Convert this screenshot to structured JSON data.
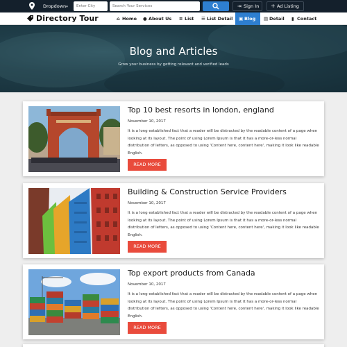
{
  "topbar": {
    "location_icon": "map-pin-icon",
    "dropdown_label": "Dropdown",
    "city_placeholder": "Enter City",
    "search_placeholder": "Search Your Services",
    "search_icon": "search-icon",
    "signin_label": "Sign In",
    "adlisting_label": "Ad Listing"
  },
  "brand": {
    "name": "Directory Tour"
  },
  "nav": {
    "items": [
      {
        "label": "Home",
        "icon": "home-icon"
      },
      {
        "label": "About Us",
        "icon": "user-icon"
      },
      {
        "label": "List",
        "icon": "list-icon"
      },
      {
        "label": "List Detail",
        "icon": "list-detail-icon"
      },
      {
        "label": "Blog",
        "icon": "image-icon",
        "active": true
      },
      {
        "label": "Detail",
        "icon": "detail-icon"
      },
      {
        "label": "Contact",
        "icon": "contact-icon"
      }
    ]
  },
  "hero": {
    "title": "Blog and Articles",
    "subtitle": "Grow your business by getting relevant and verified leads"
  },
  "posts": [
    {
      "title": "Top 10 best resorts in london, england",
      "date": "November 10, 2017",
      "excerpt": "It is a long established fact that a reader will be distracted by the readable content of a page when looking at its layout. The point of using Lorem Ipsum is that it has a more-or-less normal distribution of letters, as opposed to using 'Content here, content here', making it look like readable English.",
      "button": "READ MORE"
    },
    {
      "title": "Building & Construction Service Providers",
      "date": "November 10, 2017",
      "excerpt": "It is a long established fact that a reader will be distracted by the readable content of a page when looking at its layout. The point of using Lorem Ipsum is that it has a more-or-less normal distribution of letters, as opposed to using 'Content here, content here', making it look like readable English.",
      "button": "READ MORE"
    },
    {
      "title": "Top export products from Canada",
      "date": "November 10, 2017",
      "excerpt": "It is a long established fact that a reader will be distracted by the readable content of a page when looking at its layout. The point of using Lorem Ipsum is that it has a more-or-less normal distribution of letters, as opposed to using 'Content here, content here', making it look like readable English.",
      "button": "READ MORE"
    }
  ],
  "colors": {
    "topbar_bg": "#14202c",
    "accent_blue": "#2e7fd1",
    "button_red": "#e94b3c",
    "hero_bg": "#1f3d48"
  }
}
